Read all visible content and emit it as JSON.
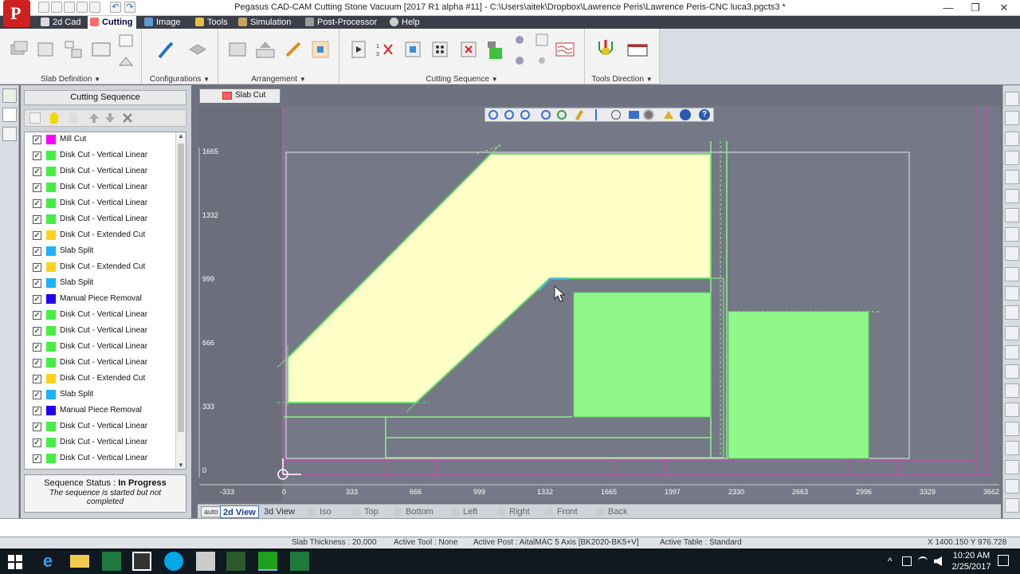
{
  "window": {
    "title": "Pegasus CAD-CAM Cutting Stone Vacuum [2017 R1 alpha #11] - C:\\Users\\aitek\\Dropbox\\Lawrence Peris\\Lawrence Peris-CNC luca3.pgcts3 *",
    "logo_letter": "P",
    "minimize": "—",
    "maximize": "❐",
    "close": "✕"
  },
  "menu": [
    {
      "label": "2d Cad",
      "icon_color": "#d9d9d9"
    },
    {
      "label": "Cutting",
      "icon_color": "#ff6a6a",
      "active": true
    },
    {
      "label": "Image",
      "icon_color": "#5b9bd5"
    },
    {
      "label": "Tools",
      "icon_color": "#e8c040"
    },
    {
      "label": "Simulation",
      "icon_color": "#c9a35a"
    },
    {
      "label": "Post-Processor",
      "icon_color": "#9a9a9a"
    },
    {
      "label": "Help",
      "icon_color": "#cfcfcf"
    }
  ],
  "ribbon": {
    "groups": [
      {
        "label": "Slab Definition"
      },
      {
        "label": "Configurations"
      },
      {
        "label": "Arrangement"
      },
      {
        "label": "Cutting Sequence"
      },
      {
        "label": "Tools Direction"
      }
    ],
    "dropdown_glyph": "▼"
  },
  "panel": {
    "title": "Cutting Sequence",
    "items": [
      {
        "label": "Mill Cut",
        "color": "#ff00ff"
      },
      {
        "label": "Disk Cut - Vertical Linear",
        "color": "#41f041"
      },
      {
        "label": "Disk Cut - Vertical Linear",
        "color": "#41f041"
      },
      {
        "label": "Disk Cut - Vertical Linear",
        "color": "#41f041"
      },
      {
        "label": "Disk Cut - Vertical Linear",
        "color": "#41f041"
      },
      {
        "label": "Disk Cut - Vertical Linear",
        "color": "#41f041"
      },
      {
        "label": "Disk Cut - Extended Cut",
        "color": "#ffd11a"
      },
      {
        "label": "Slab Split",
        "color": "#1ab2ff"
      },
      {
        "label": "Disk Cut - Extended Cut",
        "color": "#ffd11a"
      },
      {
        "label": "Slab Split",
        "color": "#1ab2ff"
      },
      {
        "label": "Manual Piece Removal",
        "color": "#2200ee"
      },
      {
        "label": "Disk Cut - Vertical Linear",
        "color": "#41f041"
      },
      {
        "label": "Disk Cut - Vertical Linear",
        "color": "#41f041"
      },
      {
        "label": "Disk Cut - Vertical Linear",
        "color": "#41f041"
      },
      {
        "label": "Disk Cut - Vertical Linear",
        "color": "#41f041"
      },
      {
        "label": "Disk Cut - Extended Cut",
        "color": "#ffd11a"
      },
      {
        "label": "Slab Split",
        "color": "#1ab2ff"
      },
      {
        "label": "Manual Piece Removal",
        "color": "#2200ee"
      },
      {
        "label": "Disk Cut - Vertical Linear",
        "color": "#41f041"
      },
      {
        "label": "Disk Cut - Vertical Linear",
        "color": "#41f041"
      },
      {
        "label": "Disk Cut - Vertical Linear",
        "color": "#41f041"
      }
    ],
    "checkmark": "✓",
    "status_label": "Sequence Status : ",
    "status_value": "In Progress",
    "status_desc": "The sequence is started but not completed"
  },
  "document_tab": "Slab Cut",
  "canvas": {
    "y_ticks": [
      "1665",
      "1332",
      "999",
      "666",
      "333",
      "0"
    ],
    "x_ticks": [
      "-333",
      "0",
      "333",
      "666",
      "999",
      "1332",
      "1665",
      "1997",
      "2330",
      "2663",
      "2996",
      "3329",
      "3662"
    ],
    "help_glyph": "?"
  },
  "viewbar": {
    "auto": "auto",
    "items": [
      "2d View",
      "3d View",
      "Iso",
      "Top",
      "Bottom",
      "Left",
      "Right",
      "Front",
      "Back"
    ]
  },
  "statusbar": {
    "slab_thickness": "Slab Thickness : 20.000",
    "active_tool": "Active Tool : None",
    "active_post": "Active Post : AitalMAC 5 Axis [BK2020-BK5+V]",
    "active_table": "Active Table : Standard",
    "coords": "X 1400.150   Y 976.728"
  },
  "taskbar": {
    "time": "10:20 AM",
    "date": "2/25/2017",
    "tray_up": "^"
  }
}
